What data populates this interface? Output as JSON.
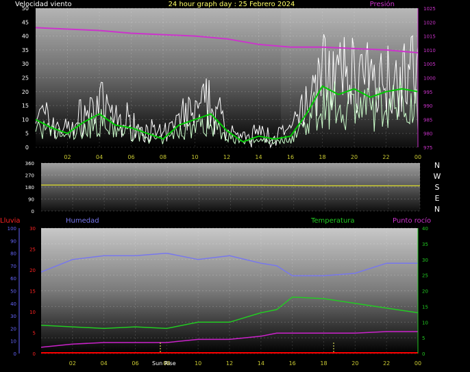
{
  "top": {
    "title": "24 hour graph day : 25 Febrero 2024",
    "left_label": "Velocidad viento",
    "right_label": "Presión",
    "left_ticks": [
      "0",
      "5",
      "10",
      "15",
      "20",
      "25",
      "30",
      "35",
      "40",
      "45",
      "50"
    ],
    "right_ticks": [
      "975",
      "980",
      "985",
      "990",
      "995",
      "1000",
      "1005",
      "1010",
      "1015",
      "1020",
      "1025"
    ],
    "x_ticks": [
      "02",
      "04",
      "06",
      "08",
      "10",
      "12",
      "14",
      "16",
      "18",
      "20",
      "22",
      "00"
    ]
  },
  "mid": {
    "left_ticks": [
      "0",
      "90",
      "180",
      "270",
      "360"
    ],
    "compass": [
      "N",
      "W",
      "S",
      "E",
      "N"
    ],
    "x_ticks": [
      "02",
      "04",
      "06",
      "08",
      "10",
      "12",
      "14",
      "16",
      "18",
      "20",
      "22",
      "00"
    ]
  },
  "bottom": {
    "rain_label": "Lluvia",
    "hum_label": "Humedad",
    "temp_label": "Temperatura",
    "dew_label": "Punto rocío",
    "hum_ticks": [
      "0",
      "10",
      "20",
      "30",
      "40",
      "50",
      "60",
      "70",
      "80",
      "90",
      "100"
    ],
    "rain_ticks": [
      "0",
      "5",
      "10",
      "15",
      "20",
      "25",
      "30"
    ],
    "temp_ticks": [
      "0",
      "5",
      "10",
      "15",
      "20",
      "25",
      "30",
      "35",
      "40"
    ],
    "x_ticks": [
      "02",
      "04",
      "06",
      "08",
      "10",
      "12",
      "14",
      "16",
      "18",
      "20",
      "22",
      "00"
    ],
    "sunrise": "Sun Rise"
  },
  "colors": {
    "wind_gust": "#ffffff",
    "wind_avg": "#ccffcc",
    "wind_trend": "#00cc00",
    "pressure": "#cc33cc",
    "direction": "#cccc33",
    "humidity": "#7777ee",
    "temperature": "#22cc22",
    "dewpoint": "#cc22cc",
    "rain": "#ff0000"
  },
  "chart_data": [
    {
      "type": "line",
      "series": [
        {
          "name": "Velocidad viento",
          "x_hours": [
            0,
            1,
            2,
            3,
            4,
            5,
            6,
            7,
            8,
            9,
            10,
            11,
            12,
            13,
            14,
            15,
            16,
            17,
            18,
            19,
            20,
            21,
            22,
            23,
            24
          ],
          "values": [
            10,
            7,
            5,
            9,
            12,
            8,
            7,
            5,
            3,
            8,
            10,
            12,
            6,
            2,
            4,
            3,
            4,
            12,
            22,
            19,
            21,
            18,
            20,
            21,
            20
          ]
        },
        {
          "name": "Presión",
          "x_hours": [
            0,
            2,
            4,
            6,
            8,
            10,
            12,
            14,
            16,
            18,
            20,
            22,
            24
          ],
          "values": [
            1018,
            1017.5,
            1017,
            1016,
            1015.5,
            1015,
            1014,
            1012,
            1011,
            1011,
            1010.5,
            1010,
            1009
          ]
        }
      ],
      "ylim": [
        0,
        50
      ],
      "y2lim": [
        975,
        1025
      ]
    },
    {
      "type": "line",
      "series": [
        {
          "name": "direction",
          "x_hours": [
            0,
            6,
            12,
            18,
            24
          ],
          "values": [
            195,
            195,
            195,
            190,
            190
          ]
        }
      ],
      "ylim": [
        0,
        360
      ]
    },
    {
      "type": "line",
      "series": [
        {
          "name": "Humedad",
          "x_hours": [
            0,
            2,
            4,
            6,
            8,
            10,
            12,
            14,
            15,
            16,
            18,
            20,
            22,
            24
          ],
          "values": [
            65,
            75,
            78,
            78,
            80,
            75,
            78,
            72,
            70,
            62,
            62,
            64,
            72,
            72
          ]
        },
        {
          "name": "Temperatura",
          "x_hours": [
            0,
            2,
            4,
            6,
            8,
            10,
            12,
            14,
            15,
            16,
            18,
            20,
            22,
            24
          ],
          "values": [
            9,
            8.5,
            8,
            8.5,
            8,
            10,
            10,
            13,
            14,
            18,
            17.5,
            16,
            14.5,
            13
          ]
        },
        {
          "name": "Punto rocío",
          "x_hours": [
            0,
            2,
            4,
            6,
            8,
            10,
            12,
            14,
            15,
            16,
            18,
            20,
            22,
            24
          ],
          "values": [
            2,
            3,
            3.5,
            3.5,
            3.5,
            4.5,
            4.5,
            5.5,
            6.5,
            6.5,
            6.5,
            6.5,
            7,
            7
          ]
        },
        {
          "name": "Lluvia",
          "x_hours": [
            0,
            24
          ],
          "values": [
            0,
            0
          ]
        }
      ]
    }
  ]
}
